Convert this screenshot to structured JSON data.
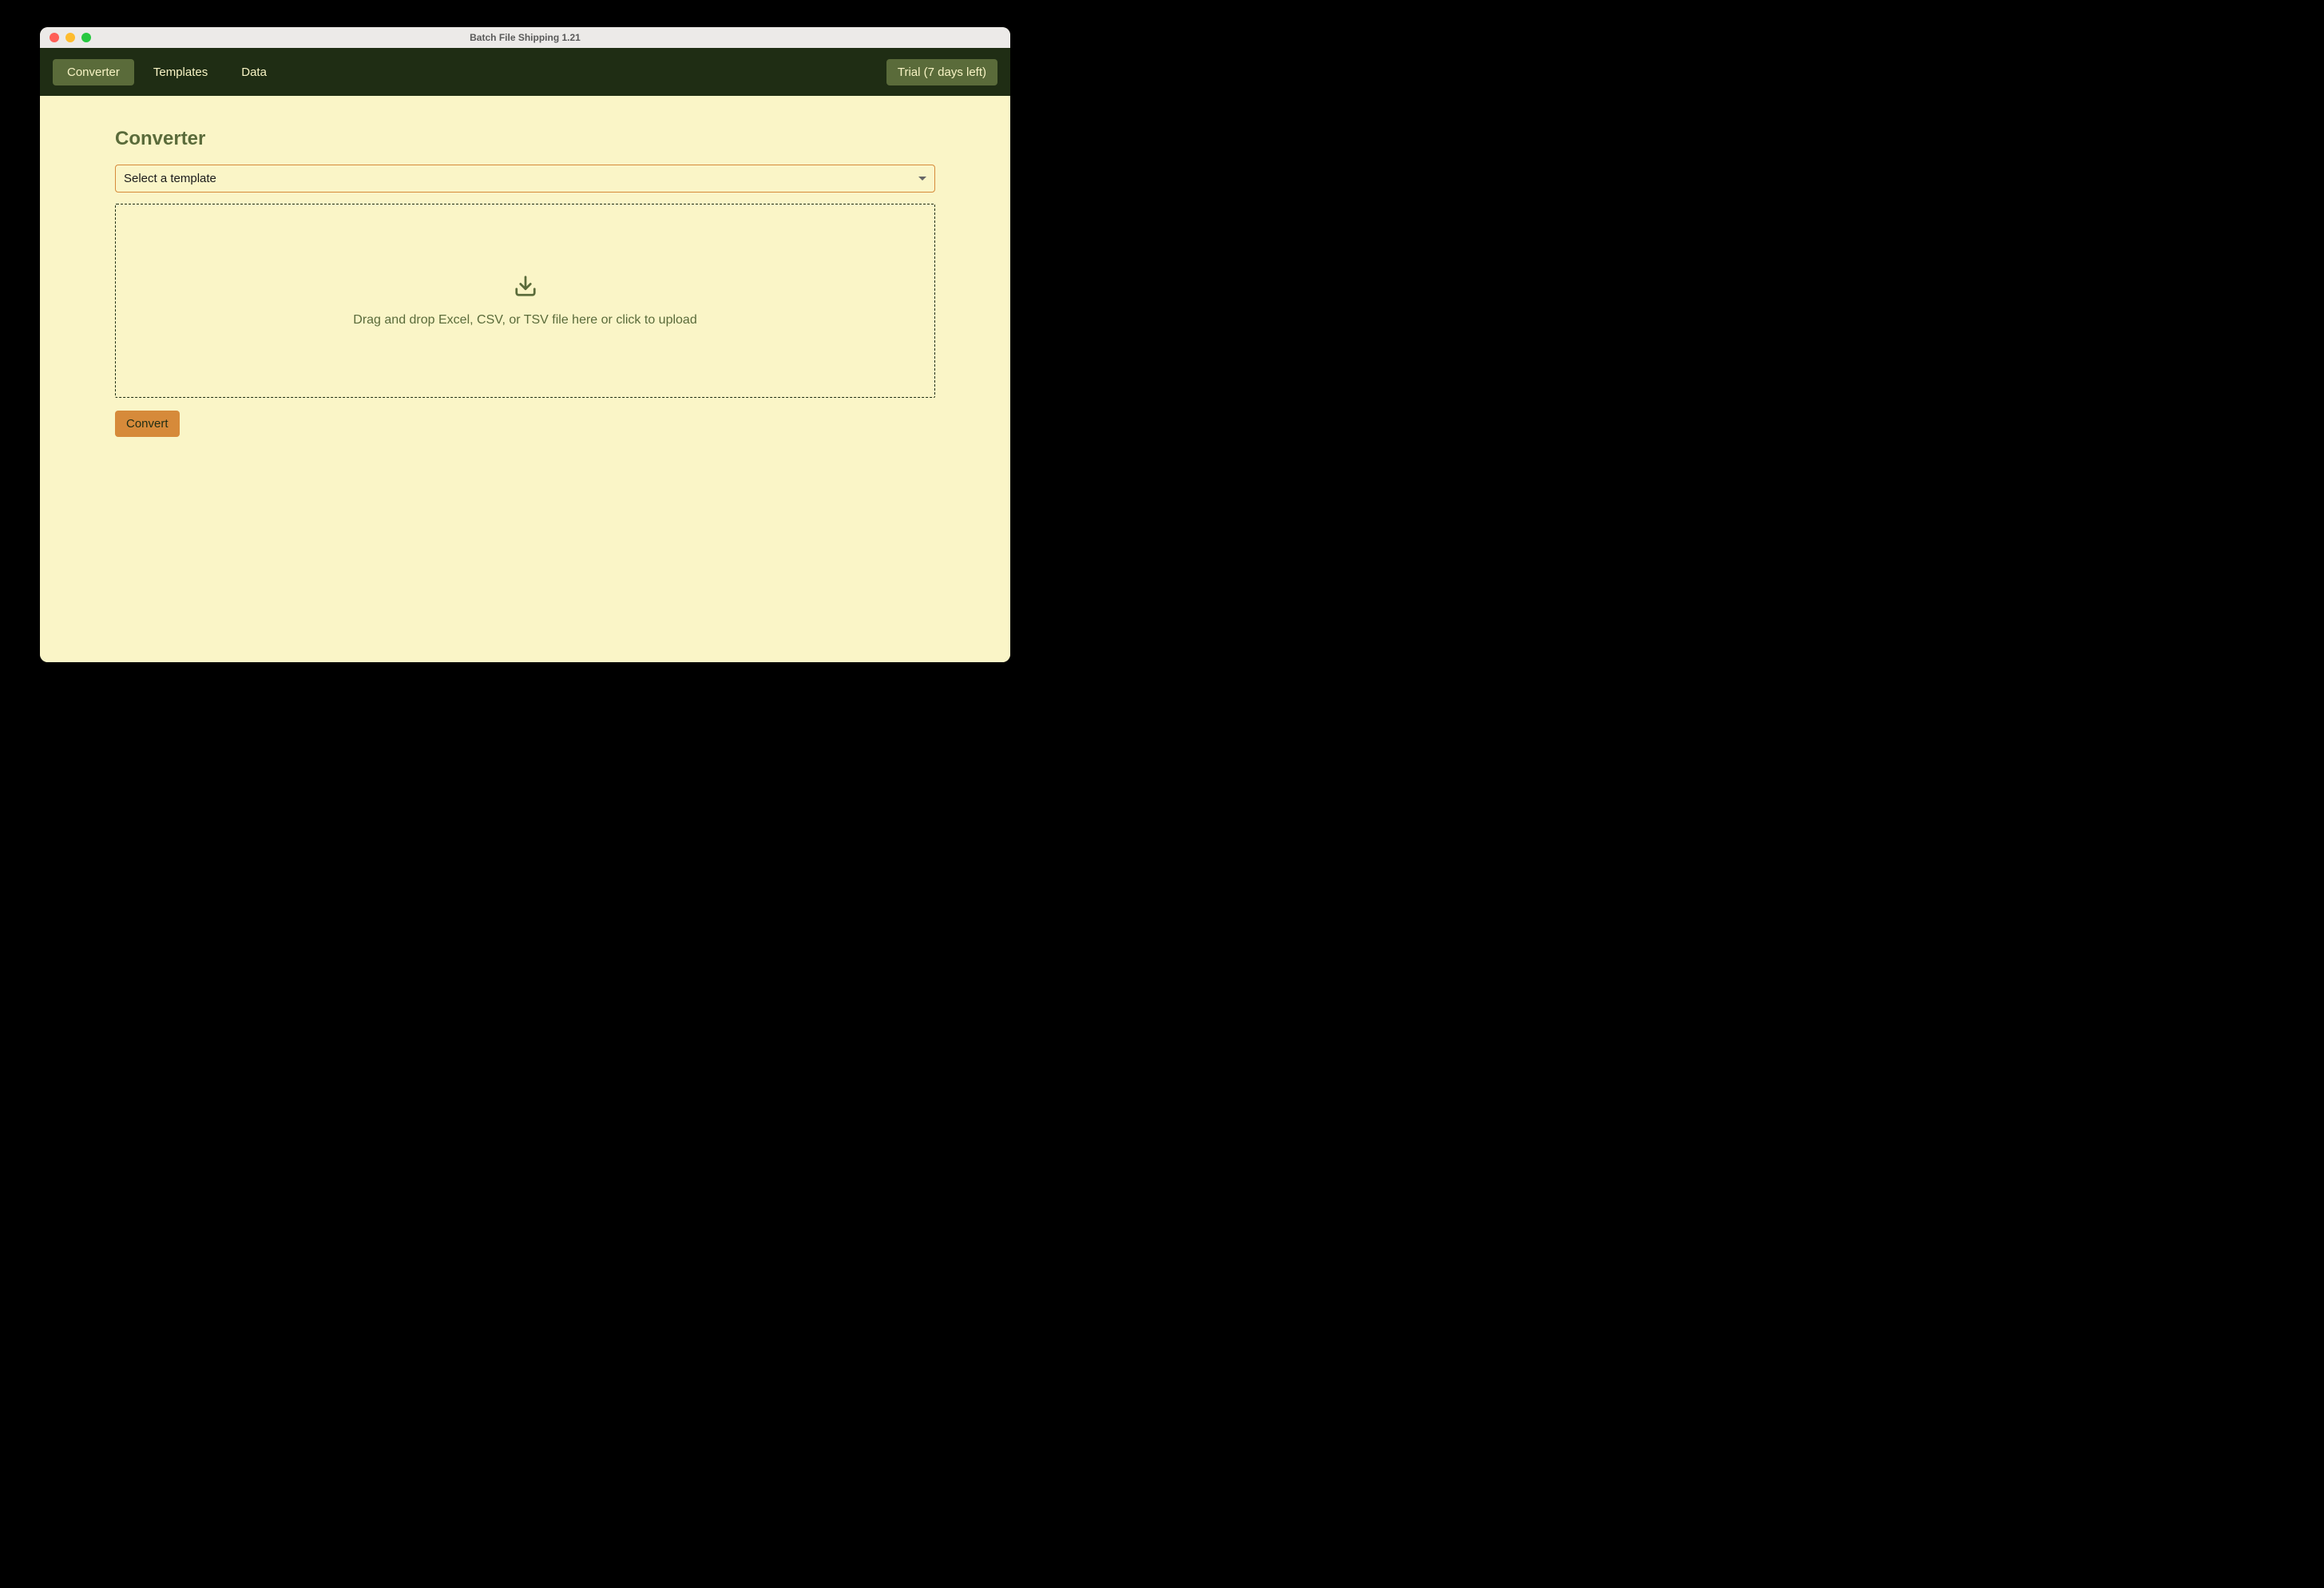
{
  "window": {
    "title": "Batch File Shipping 1.21"
  },
  "navbar": {
    "items": [
      {
        "label": "Converter",
        "active": true
      },
      {
        "label": "Templates",
        "active": false
      },
      {
        "label": "Data",
        "active": false
      }
    ],
    "trial_label": "Trial (7 days left)"
  },
  "page": {
    "title": "Converter",
    "template_select": {
      "placeholder": "Select a template"
    },
    "dropzone": {
      "text": "Drag and drop Excel, CSV, or TSV file here or click to upload"
    },
    "convert_button_label": "Convert"
  }
}
